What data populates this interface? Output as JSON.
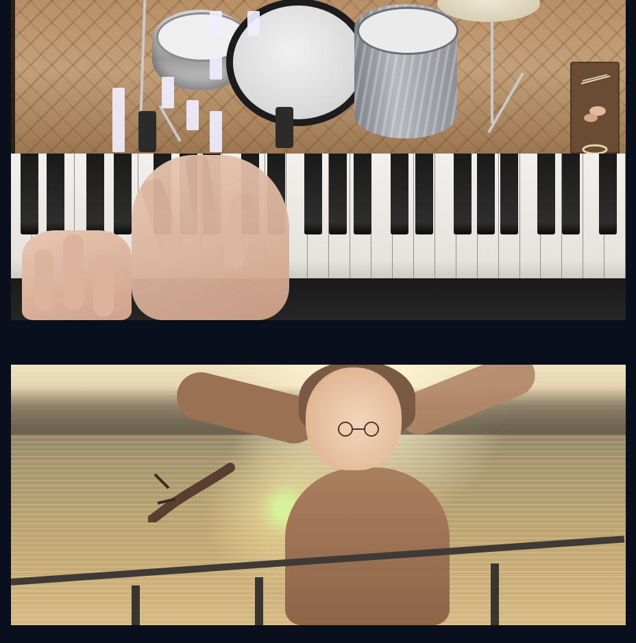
{
  "icons": {
    "sticks": "drumsticks-icon",
    "shaker": "shaker-icon",
    "tambourine": "tambourine-icon",
    "glasses": "glasses-icon"
  },
  "colors": {
    "page_background": "#07101c",
    "note_bar": "#f0eeff",
    "instrument_panel": "#6a4c35"
  }
}
